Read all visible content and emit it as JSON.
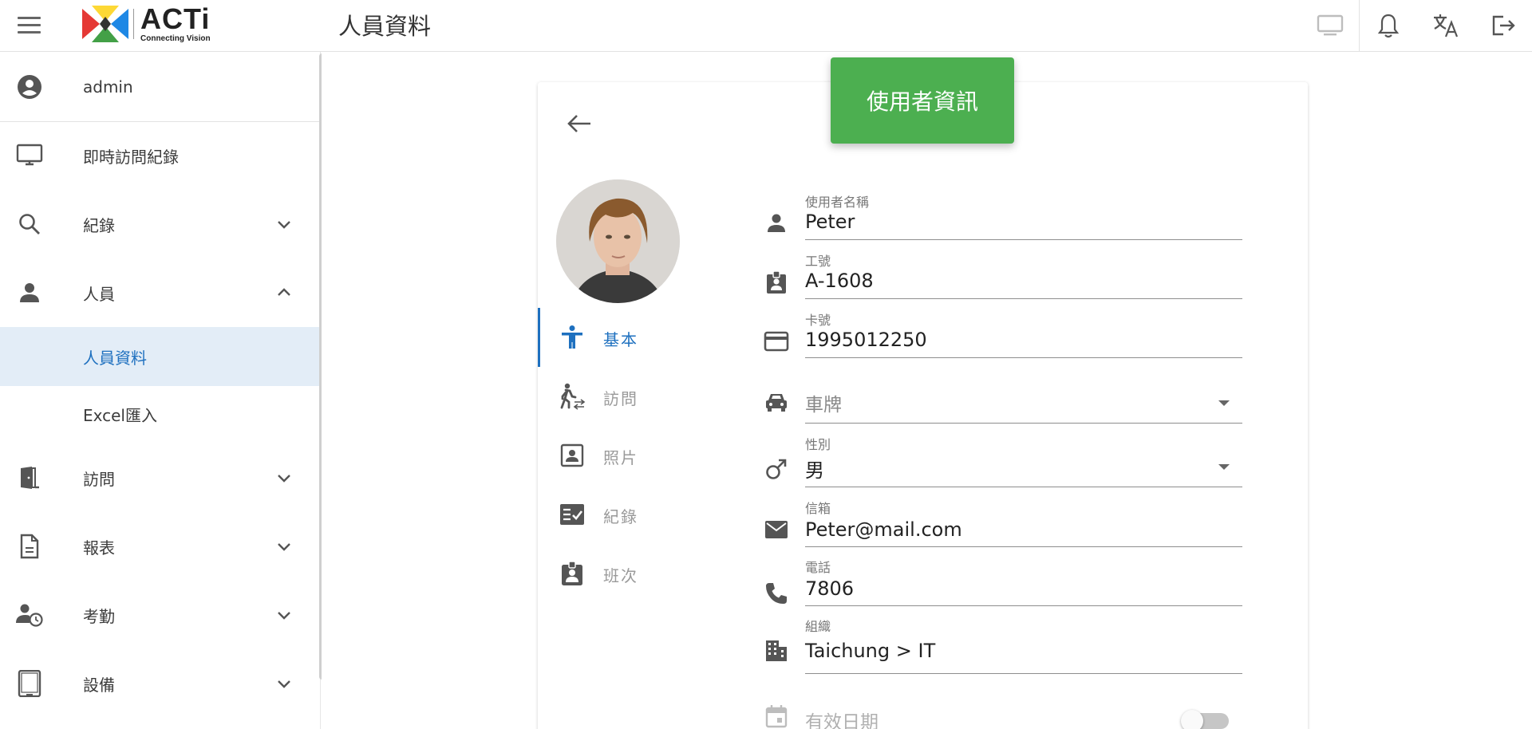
{
  "app": {
    "logo_word": "ACTi",
    "logo_sub": "Connecting Vision",
    "page_title": "人員資料"
  },
  "topbar": {
    "icons": [
      "monitor-icon",
      "bell-icon",
      "translate-icon",
      "logout-icon"
    ]
  },
  "sidebar": {
    "user": "admin",
    "items": [
      {
        "label": "即時訪問紀錄",
        "icon": "monitor-icon"
      },
      {
        "label": "紀錄",
        "icon": "search-icon",
        "expand": "down"
      },
      {
        "label": "人員",
        "icon": "person-icon",
        "expand": "up"
      },
      {
        "label": "人員資料",
        "active": true
      },
      {
        "label": "Excel匯入"
      },
      {
        "label": "訪問",
        "icon": "door-icon",
        "expand": "down"
      },
      {
        "label": "報表",
        "icon": "document-icon",
        "expand": "down"
      },
      {
        "label": "考勤",
        "icon": "person-clock-icon",
        "expand": "down"
      },
      {
        "label": "設備",
        "icon": "tablet-icon",
        "expand": "down"
      }
    ]
  },
  "card": {
    "header": "使用者資訊",
    "tabs": [
      {
        "label": "基本",
        "icon": "accessibility-icon",
        "active": true
      },
      {
        "label": "訪問",
        "icon": "walking-icon"
      },
      {
        "label": "照片",
        "icon": "portrait-icon"
      },
      {
        "label": "紀錄",
        "icon": "checklist-icon"
      },
      {
        "label": "班次",
        "icon": "badge-icon"
      }
    ],
    "fields": {
      "username": {
        "label": "使用者名稱",
        "value": "Peter"
      },
      "employee_id": {
        "label": "工號",
        "value": "A-1608"
      },
      "card_no": {
        "label": "卡號",
        "value": "1995012250"
      },
      "plate": {
        "placeholder": "車牌"
      },
      "gender": {
        "label": "性別",
        "value": "男"
      },
      "email": {
        "label": "信箱",
        "value": "Peter@mail.com"
      },
      "phone": {
        "label": "電話",
        "value": "7806"
      },
      "org": {
        "label": "組織",
        "value": "Taichung > IT"
      },
      "valid_date": {
        "placeholder": "有效日期",
        "enabled": false
      }
    }
  },
  "colors": {
    "accent": "#1e70bf",
    "header_green": "#4caf50",
    "active_bg": "#e3edf7"
  }
}
